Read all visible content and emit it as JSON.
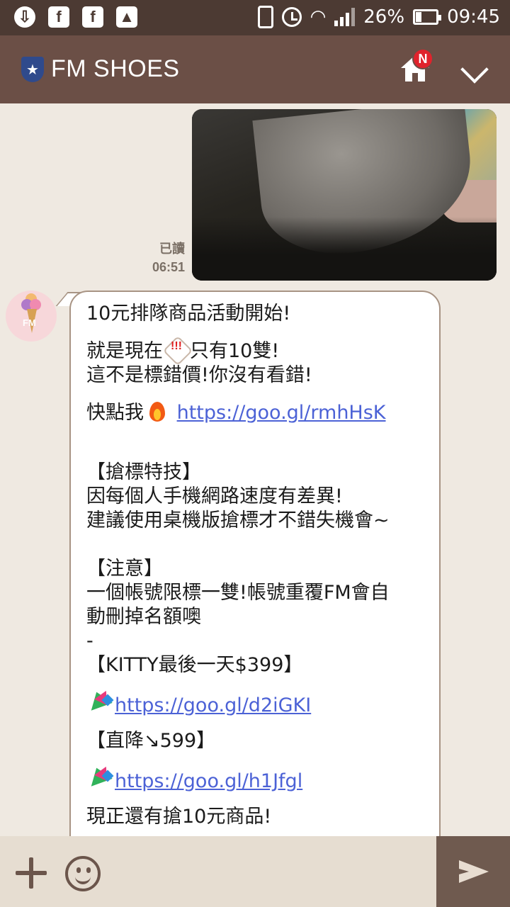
{
  "status_bar": {
    "left_icons": [
      "sync-icon",
      "facebook-icon",
      "facebook-icon",
      "gallery-icon"
    ],
    "battery": "26%",
    "time": "09:45"
  },
  "header": {
    "title": "FM SHOES",
    "notification_badge": "N"
  },
  "messages": {
    "photo": {
      "read_label": "已讀",
      "time": "06:51"
    },
    "incoming": {
      "avatar_label": "FM",
      "line1": "10元排隊商品活動開始!",
      "line2a": "就是現在",
      "line2b": "只有10雙!",
      "line3": "這不是標錯價!你沒有看錯!",
      "line4": "快點我",
      "link1": "https://goo.gl/rmhHsK",
      "tips_title": "【搶標特技】",
      "tips_line1": "因每個人手機網路速度有差異!",
      "tips_line2": "建議使用桌機版搶標才不錯失機會~",
      "note_title": "【注意】",
      "note_line1": "一個帳號限標一雙!帳號重覆FM會自",
      "note_line2": "動刪掉名額噢",
      "dash": "-",
      "kitty_title": "【KITTY最後一天$399】",
      "link2": "https://goo.gl/d2iGKI",
      "drop_title": "【直降↘599】",
      "link3": "https://goo.gl/h1Jfgl",
      "cut_line": "現正還有搶10元商品!"
    }
  },
  "colors": {
    "status_bar": "#4c3a33",
    "header": "#6b4f46",
    "chat_bg": "#efe9e1",
    "link": "#4c62d6",
    "badge": "#e0232c"
  }
}
